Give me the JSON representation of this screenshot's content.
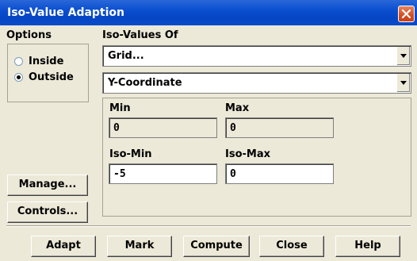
{
  "window": {
    "title": "Iso-Value Adaption"
  },
  "options": {
    "label": "Options",
    "items": [
      {
        "label": "Inside",
        "checked": false
      },
      {
        "label": "Outside",
        "checked": true
      }
    ]
  },
  "iso_values_of": {
    "label": "Iso-Values Of",
    "category": "Grid...",
    "quantity": "Y-Coordinate"
  },
  "range": {
    "min_label": "Min",
    "min_value": "0",
    "max_label": "Max",
    "max_value": "0",
    "iso_min_label": "Iso-Min",
    "iso_min_value": "-5",
    "iso_max_label": "Iso-Max",
    "iso_max_value": "0"
  },
  "side_buttons": {
    "manage": "Manage...",
    "controls": "Controls..."
  },
  "footer": {
    "adapt": "Adapt",
    "mark": "Mark",
    "compute": "Compute",
    "close": "Close",
    "help": "Help"
  },
  "colors": {
    "titlebar": "#0A4FD0",
    "window_bg": "#ECE9D8",
    "close_button": "#D24E22"
  }
}
